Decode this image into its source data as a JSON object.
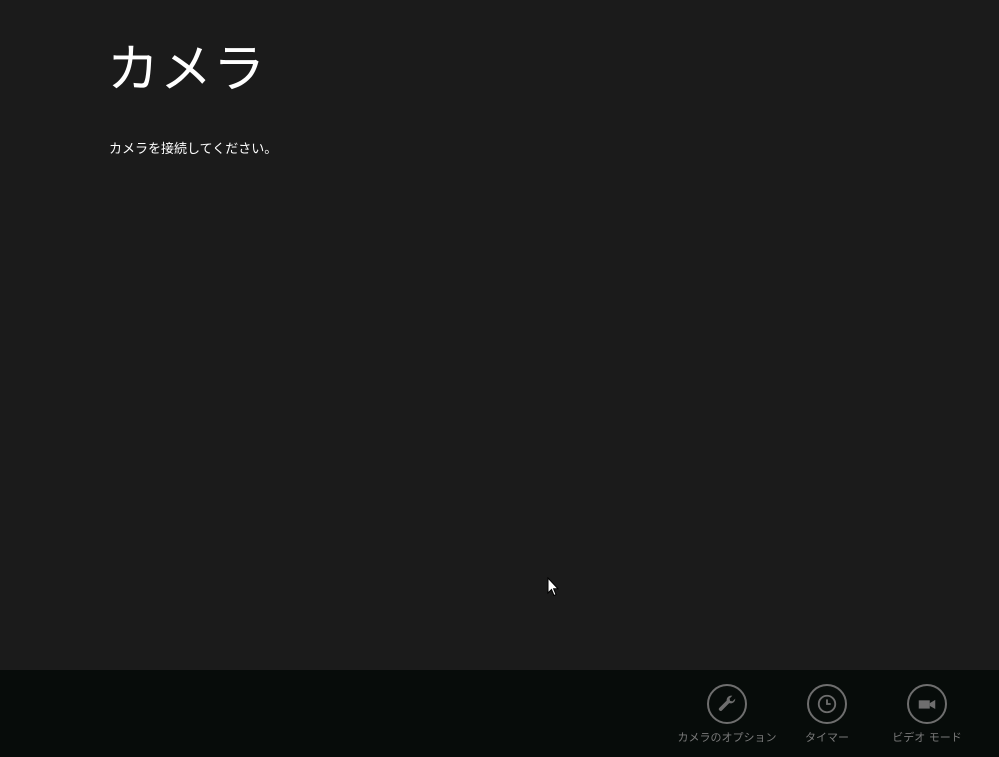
{
  "app": {
    "title": "カメラ",
    "message": "カメラを接続してください。"
  },
  "appbar": {
    "commands": [
      {
        "icon": "wrench-icon",
        "label": "カメラのオプション"
      },
      {
        "icon": "clock-icon",
        "label": "タイマー"
      },
      {
        "icon": "video-camera-icon",
        "label": "ビデオ モード"
      }
    ]
  },
  "colors": {
    "background": "#1b1b1b",
    "appbar_background": "#070c0a",
    "text": "#ffffff",
    "disabled": "#6e6e6e"
  }
}
